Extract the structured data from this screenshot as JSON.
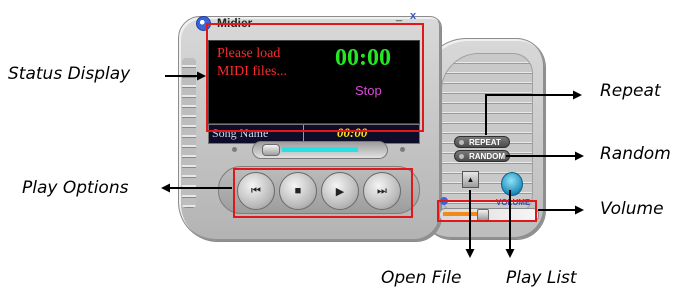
{
  "window": {
    "title": "Midier",
    "minimize_glyph": "_",
    "close_glyph": "x"
  },
  "display": {
    "message_line1": "Please load",
    "message_line2": "MIDI files...",
    "clock": "00:00",
    "state": "Stop",
    "song_name_label": "Song Name",
    "song_time": "00:00"
  },
  "seek": {
    "progress": 0.0
  },
  "controls": {
    "prev_glyph": "⏮",
    "stop_glyph": "■",
    "play_glyph": "▶",
    "next_glyph": "⏭",
    "repeat_label": "REPEAT",
    "random_label": "RANDOM",
    "open_glyph": "▲",
    "volume_label": "VOLUME",
    "volume_level": 0.4
  },
  "annotations": {
    "status_display": "Status Display",
    "play_options": "Play Options",
    "repeat": "Repeat",
    "random": "Random",
    "volume": "Volume",
    "open_file": "Open File",
    "play_list": "Play List"
  },
  "colors": {
    "highlight": "#e2171a",
    "clock_green": "#23e823",
    "message_red": "#ff2b2b",
    "state_magenta": "#d64bd6",
    "seek_cyan": "#24e1e6",
    "volume_orange": "#f08a1d"
  }
}
